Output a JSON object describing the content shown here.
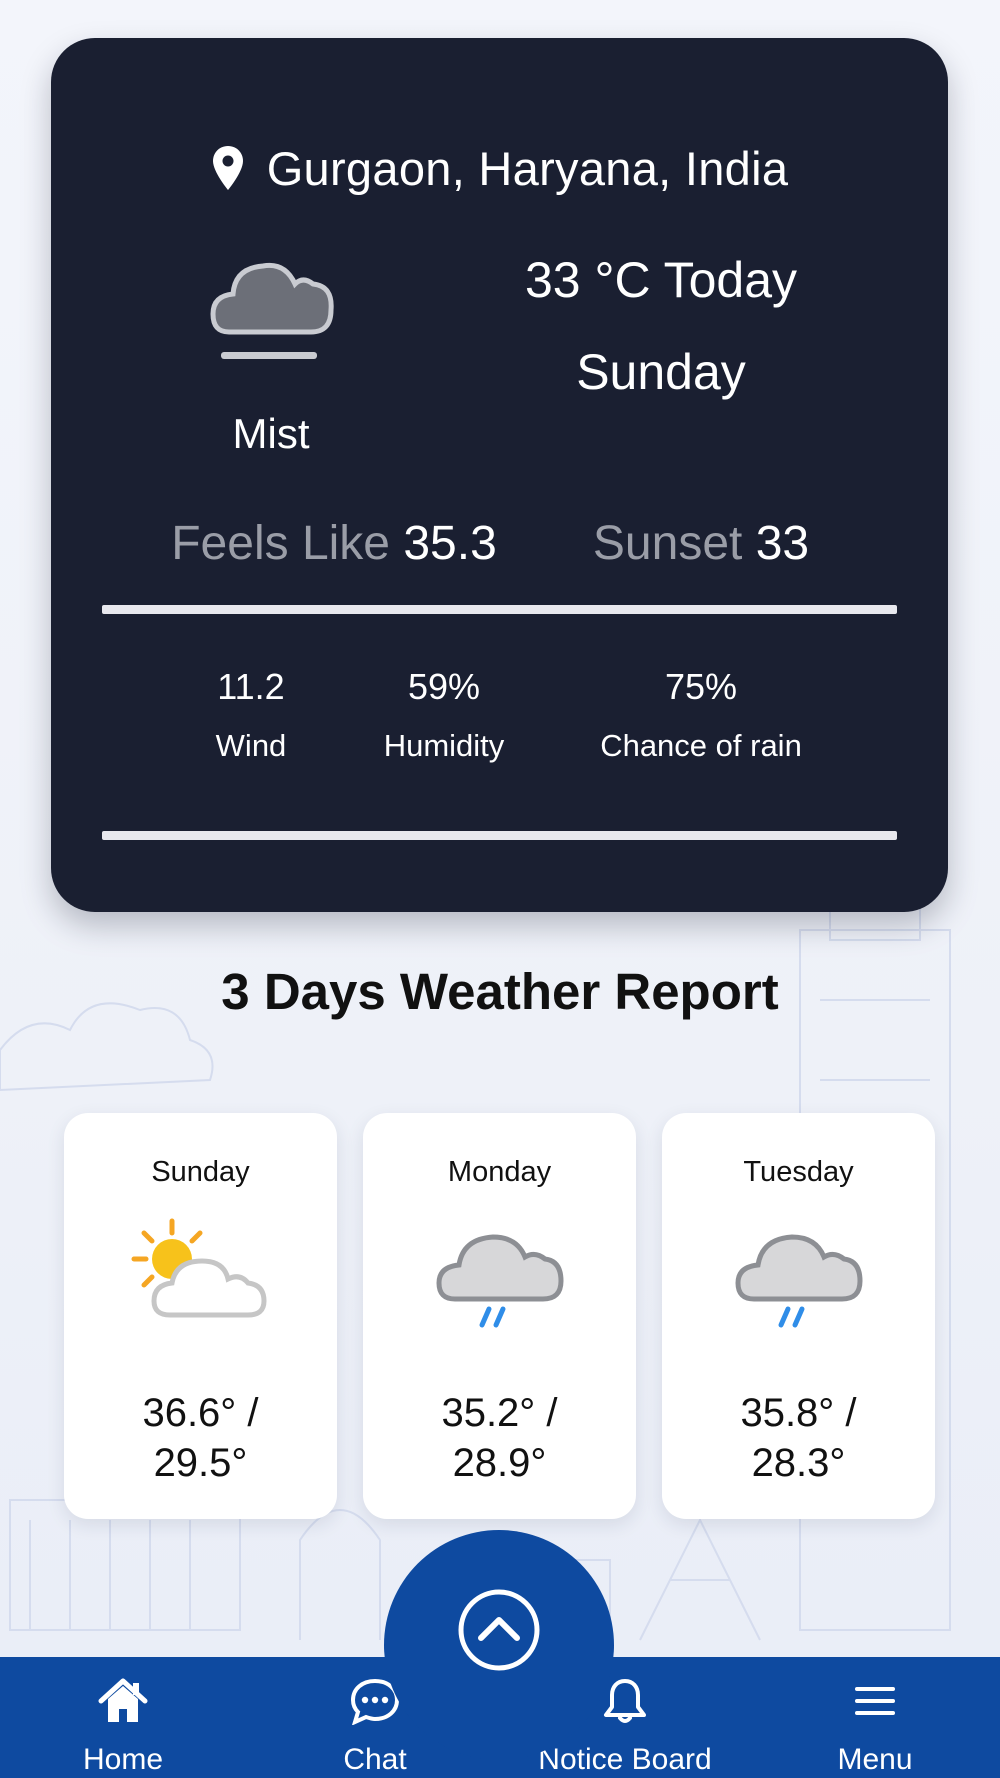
{
  "current": {
    "location": "Gurgaon, Haryana, India",
    "condition": "Mist",
    "condition_icon": "mist-cloud-icon",
    "temperature": "33 °C Today",
    "day": "Sunday",
    "feels_like_label": "Feels Like",
    "feels_like_value": "35.3",
    "sunset_label": "Sunset",
    "sunset_value": "33",
    "stats": {
      "wind_value": "11.2",
      "wind_label": "Wind",
      "humidity_value": "59%",
      "humidity_label": "Humidity",
      "rain_value": "75%",
      "rain_label": "Chance of rain"
    }
  },
  "forecast": {
    "title": "3 Days Weather Report",
    "days": [
      {
        "day": "Sunday",
        "icon": "sun-behind-cloud-icon",
        "high": "36.6° /",
        "low": "29.5°"
      },
      {
        "day": "Monday",
        "icon": "rain-cloud-icon",
        "high": "35.2° /",
        "low": "28.9°"
      },
      {
        "day": "Tuesday",
        "icon": "rain-cloud-icon",
        "high": "35.8° /",
        "low": "28.3°"
      }
    ]
  },
  "nav": {
    "items": [
      {
        "label": "Home",
        "icon": "home-icon"
      },
      {
        "label": "Chat",
        "icon": "chat-icon"
      },
      {
        "label": "Notice Board",
        "icon": "bell-icon"
      },
      {
        "label": "Menu",
        "icon": "hamburger-menu-icon"
      }
    ]
  },
  "colors": {
    "card_dark": "#1a1f31",
    "nav_blue": "#0e4aa0",
    "muted_text": "#9a9da7",
    "rain_blue": "#2f8de8",
    "sun_yellow": "#f7c21b"
  }
}
